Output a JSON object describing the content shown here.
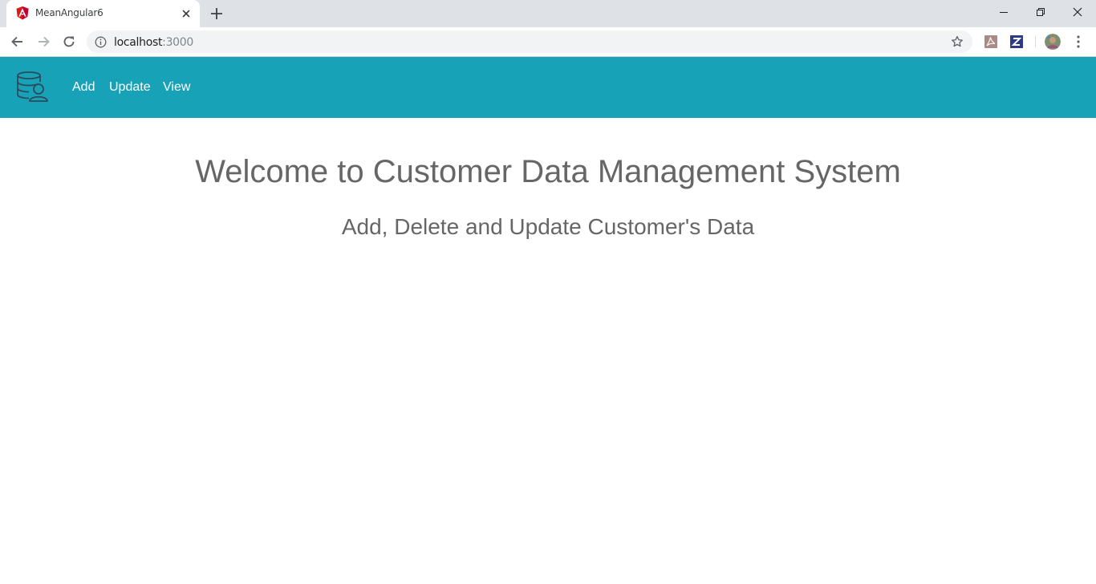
{
  "browser": {
    "tab": {
      "title": "MeanAngular6",
      "favicon": "angular-icon"
    },
    "address_bar": {
      "host": "localhost",
      "port": ":3000"
    },
    "extensions": [
      "pdf-extension-icon",
      "z-extension-icon"
    ],
    "colors": {
      "tabstrip": "#dee1e6",
      "omnibox": "#f1f3f4"
    }
  },
  "navbar": {
    "logo": "database-user-icon",
    "links": [
      {
        "label": "Add"
      },
      {
        "label": "Update"
      },
      {
        "label": "View"
      }
    ],
    "colors": {
      "background": "#17a2b8",
      "link": "#ffffff"
    }
  },
  "main": {
    "heading": "Welcome to Customer Data Management System",
    "subheading": "Add, Delete and Update Customer's Data",
    "colors": {
      "text": "#666666"
    }
  }
}
